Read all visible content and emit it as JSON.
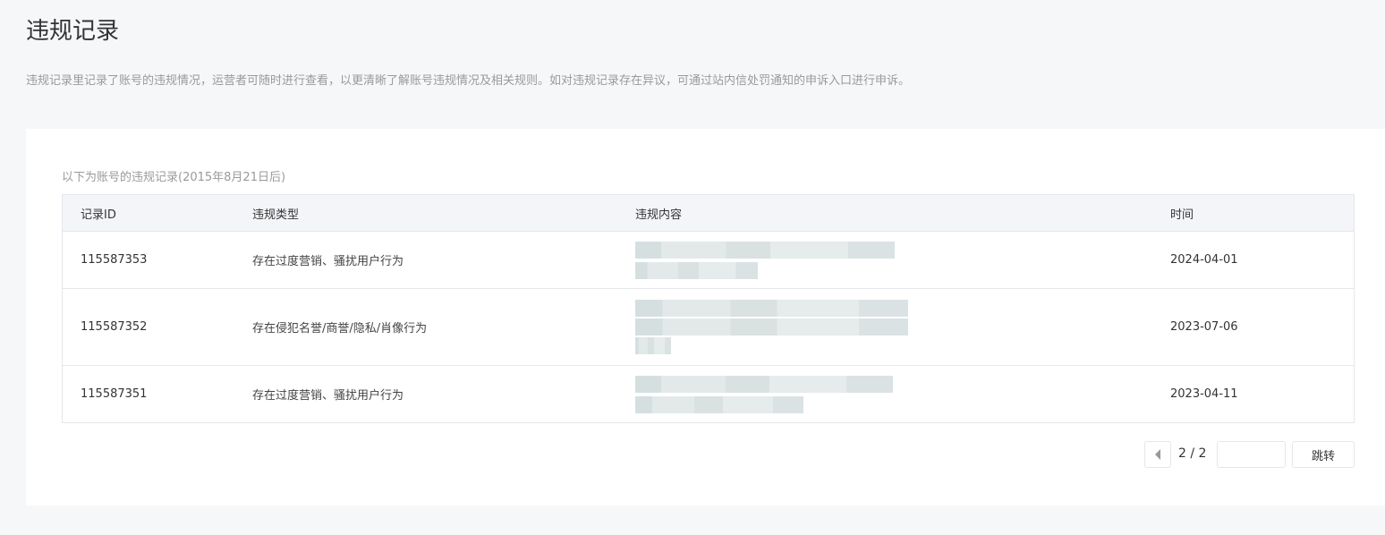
{
  "header": {
    "title": "违规记录",
    "description": "违规记录里记录了账号的违规情况，运营者可随时进行查看，以更清晰了解账号违规情况及相关规则。如对违规记录存在异议，可通过站内信处罚通知的申诉入口进行申诉。"
  },
  "card": {
    "subtitle": "以下为账号的违规记录(2015年8月21日后)"
  },
  "table": {
    "columns": [
      "记录ID",
      "违规类型",
      "违规内容",
      "时间"
    ],
    "rows": [
      {
        "id": "115587353",
        "type": "存在过度营销、骚扰用户行为",
        "date": "2024-04-01"
      },
      {
        "id": "115587352",
        "type": "存在侵犯名誉/商誉/隐私/肖像行为",
        "date": "2023-07-06"
      },
      {
        "id": "115587351",
        "type": "存在过度营销、骚扰用户行为",
        "date": "2023-04-11"
      }
    ]
  },
  "pagination": {
    "page_count": "2 / 2",
    "jump_input_value": "",
    "jump_label": "跳转"
  }
}
